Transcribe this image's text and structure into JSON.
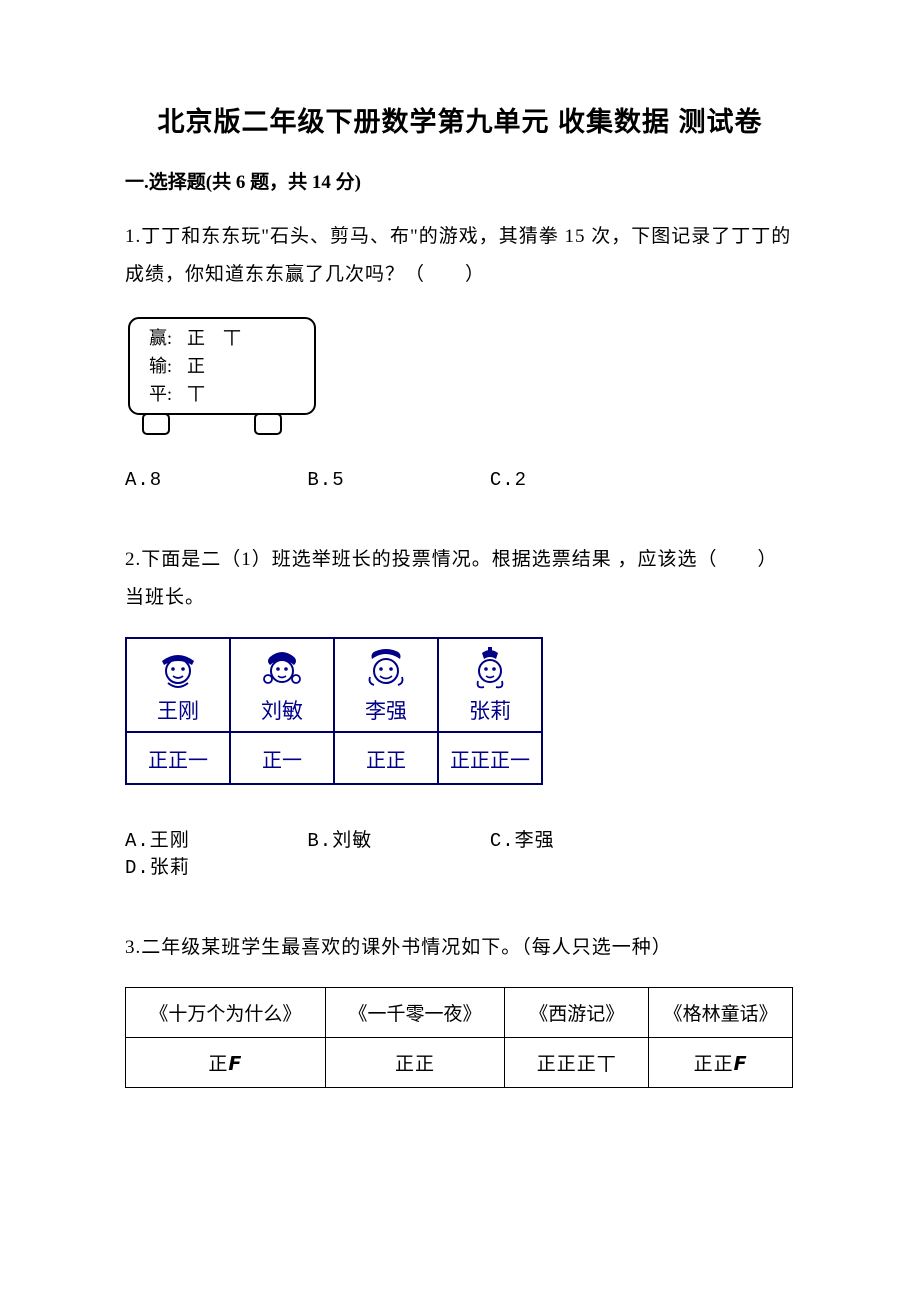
{
  "title": "北京版二年级下册数学第九单元 收集数据 测试卷",
  "section1": {
    "header": "一.选择题(共 6 题，共 14 分)"
  },
  "q1": {
    "text": "1.丁丁和东东玩\"石头、剪马、布\"的游戏，其猜拳 15 次，下图记录了丁丁的成绩，你知道东东赢了几次吗？（　　）",
    "tally": {
      "win_label": "赢:",
      "win_marks": "正　丅",
      "lose_label": "输:",
      "lose_marks": "正",
      "draw_label": "平:",
      "draw_marks": "丅"
    },
    "opts": {
      "a": "A.8",
      "b": "B.5",
      "c": "C.2"
    }
  },
  "q2": {
    "text": "2.下面是二（1）班选举班长的投票情况。根据选票结果 ，应该选（　　）当班长。",
    "names": [
      "王刚",
      "刘敏",
      "李强",
      "张莉"
    ],
    "tallies": [
      "正正一",
      "正一",
      "正正",
      "正正正一"
    ],
    "opts": {
      "a": "A.王刚",
      "b": "B.刘敏",
      "c": "C.李强",
      "d": "D.张莉"
    }
  },
  "q3": {
    "text": "3.二年级某班学生最喜欢的课外书情况如下。（每人只选一种）",
    "books": [
      "《十万个为什么》",
      "《一千零一夜》",
      "《西游记》",
      "《格林童话》"
    ],
    "tallies": [
      "正𝙁",
      "正正",
      "正正正丅",
      "正正𝙁"
    ]
  }
}
